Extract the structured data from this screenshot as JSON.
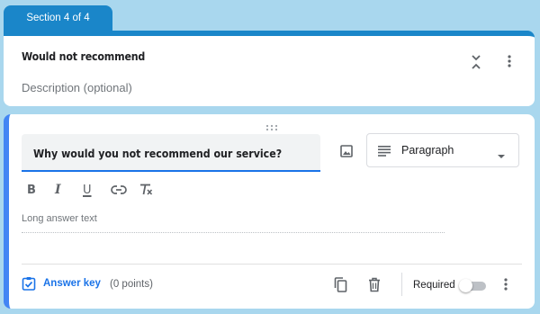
{
  "colors": {
    "background": "#a9d7ee",
    "section_accent": "#1a86c9",
    "question_accent": "#4285f4",
    "link": "#1a73e8"
  },
  "section": {
    "tab_label": "Section 4 of 4",
    "title": "Would not recommend",
    "description_placeholder": "Description (optional)",
    "icons": [
      "collapse-icon",
      "more-vert-icon"
    ]
  },
  "question": {
    "title": "Why would you not recommend our service?",
    "type_label": "Paragraph",
    "formatting_icons": [
      "bold-icon",
      "italic-icon",
      "underline-icon",
      "link-icon",
      "clear-format-icon"
    ],
    "formatting_glyphs": {
      "bold": "B",
      "italic": "I",
      "underline": "U"
    },
    "answer_placeholder": "Long answer text",
    "answer_key_label": "Answer key",
    "points_label": "(0 points)",
    "required_label": "Required",
    "required": false
  }
}
